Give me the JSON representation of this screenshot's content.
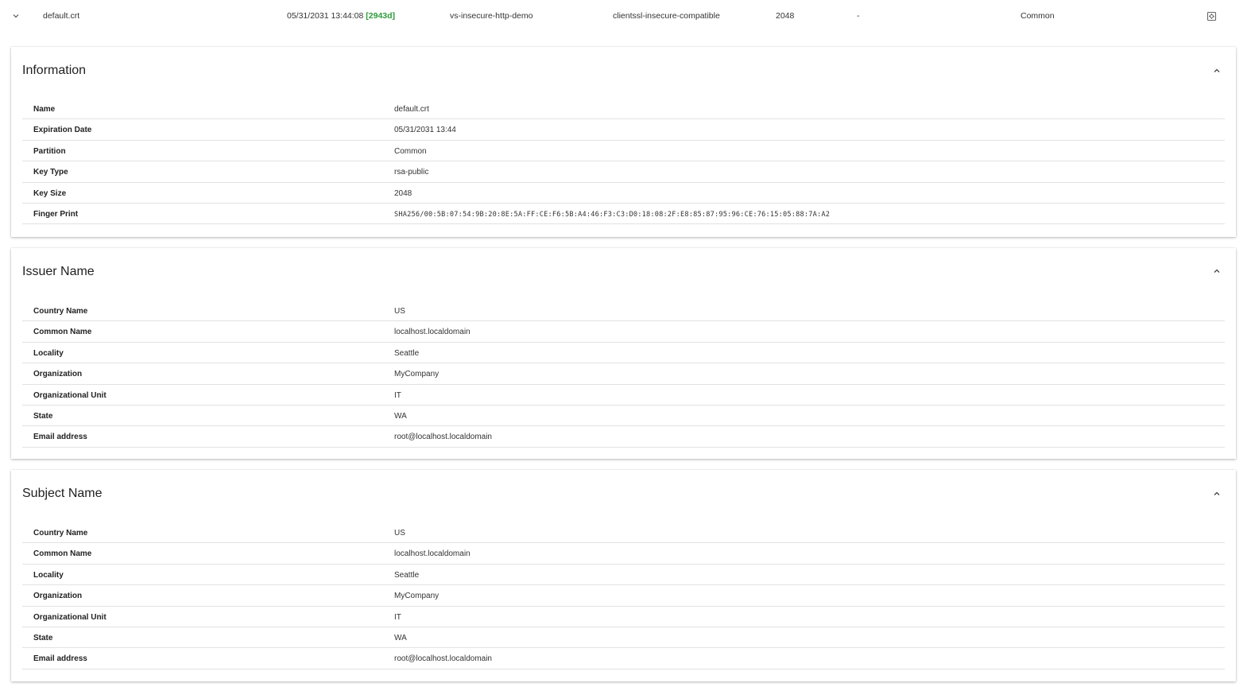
{
  "summary": {
    "name": "default.crt",
    "expiration": "05/31/2031 13:44:08",
    "days_left": "[2943d]",
    "virtual_server": "vs-insecure-http-demo",
    "profile": "clientssl-insecure-compatible",
    "key_size": "2048",
    "dash": "-",
    "partition": "Common",
    "icons": {
      "expand": "chevron-down-icon",
      "action": "settings-icon"
    },
    "colors": {
      "days_ok": "#2e9b3b"
    }
  },
  "information": {
    "title": "Information",
    "rows": [
      {
        "key": "Name",
        "value": "default.crt"
      },
      {
        "key": "Expiration Date",
        "value": "05/31/2031 13:44"
      },
      {
        "key": "Partition",
        "value": "Common"
      },
      {
        "key": "Key Type",
        "value": "rsa-public"
      },
      {
        "key": "Key Size",
        "value": "2048"
      },
      {
        "key": "Finger Print",
        "value": "SHA256/00:5B:07:54:9B:20:8E:5A:FF:CE:F6:5B:A4:46:F3:C3:D0:18:08:2F:E8:85:87:95:96:CE:76:15:05:88:7A:A2"
      }
    ]
  },
  "issuer": {
    "title": "Issuer Name",
    "rows": [
      {
        "key": "Country Name",
        "value": "US"
      },
      {
        "key": "Common Name",
        "value": "localhost.localdomain"
      },
      {
        "key": "Locality",
        "value": "Seattle"
      },
      {
        "key": "Organization",
        "value": "MyCompany"
      },
      {
        "key": "Organizational Unit",
        "value": "IT"
      },
      {
        "key": "State",
        "value": "WA"
      },
      {
        "key": "Email address",
        "value": "root@localhost.localdomain"
      }
    ]
  },
  "subject": {
    "title": "Subject Name",
    "rows": [
      {
        "key": "Country Name",
        "value": "US"
      },
      {
        "key": "Common Name",
        "value": "localhost.localdomain"
      },
      {
        "key": "Locality",
        "value": "Seattle"
      },
      {
        "key": "Organization",
        "value": "MyCompany"
      },
      {
        "key": "Organizational Unit",
        "value": "IT"
      },
      {
        "key": "State",
        "value": "WA"
      },
      {
        "key": "Email address",
        "value": "root@localhost.localdomain"
      }
    ]
  }
}
